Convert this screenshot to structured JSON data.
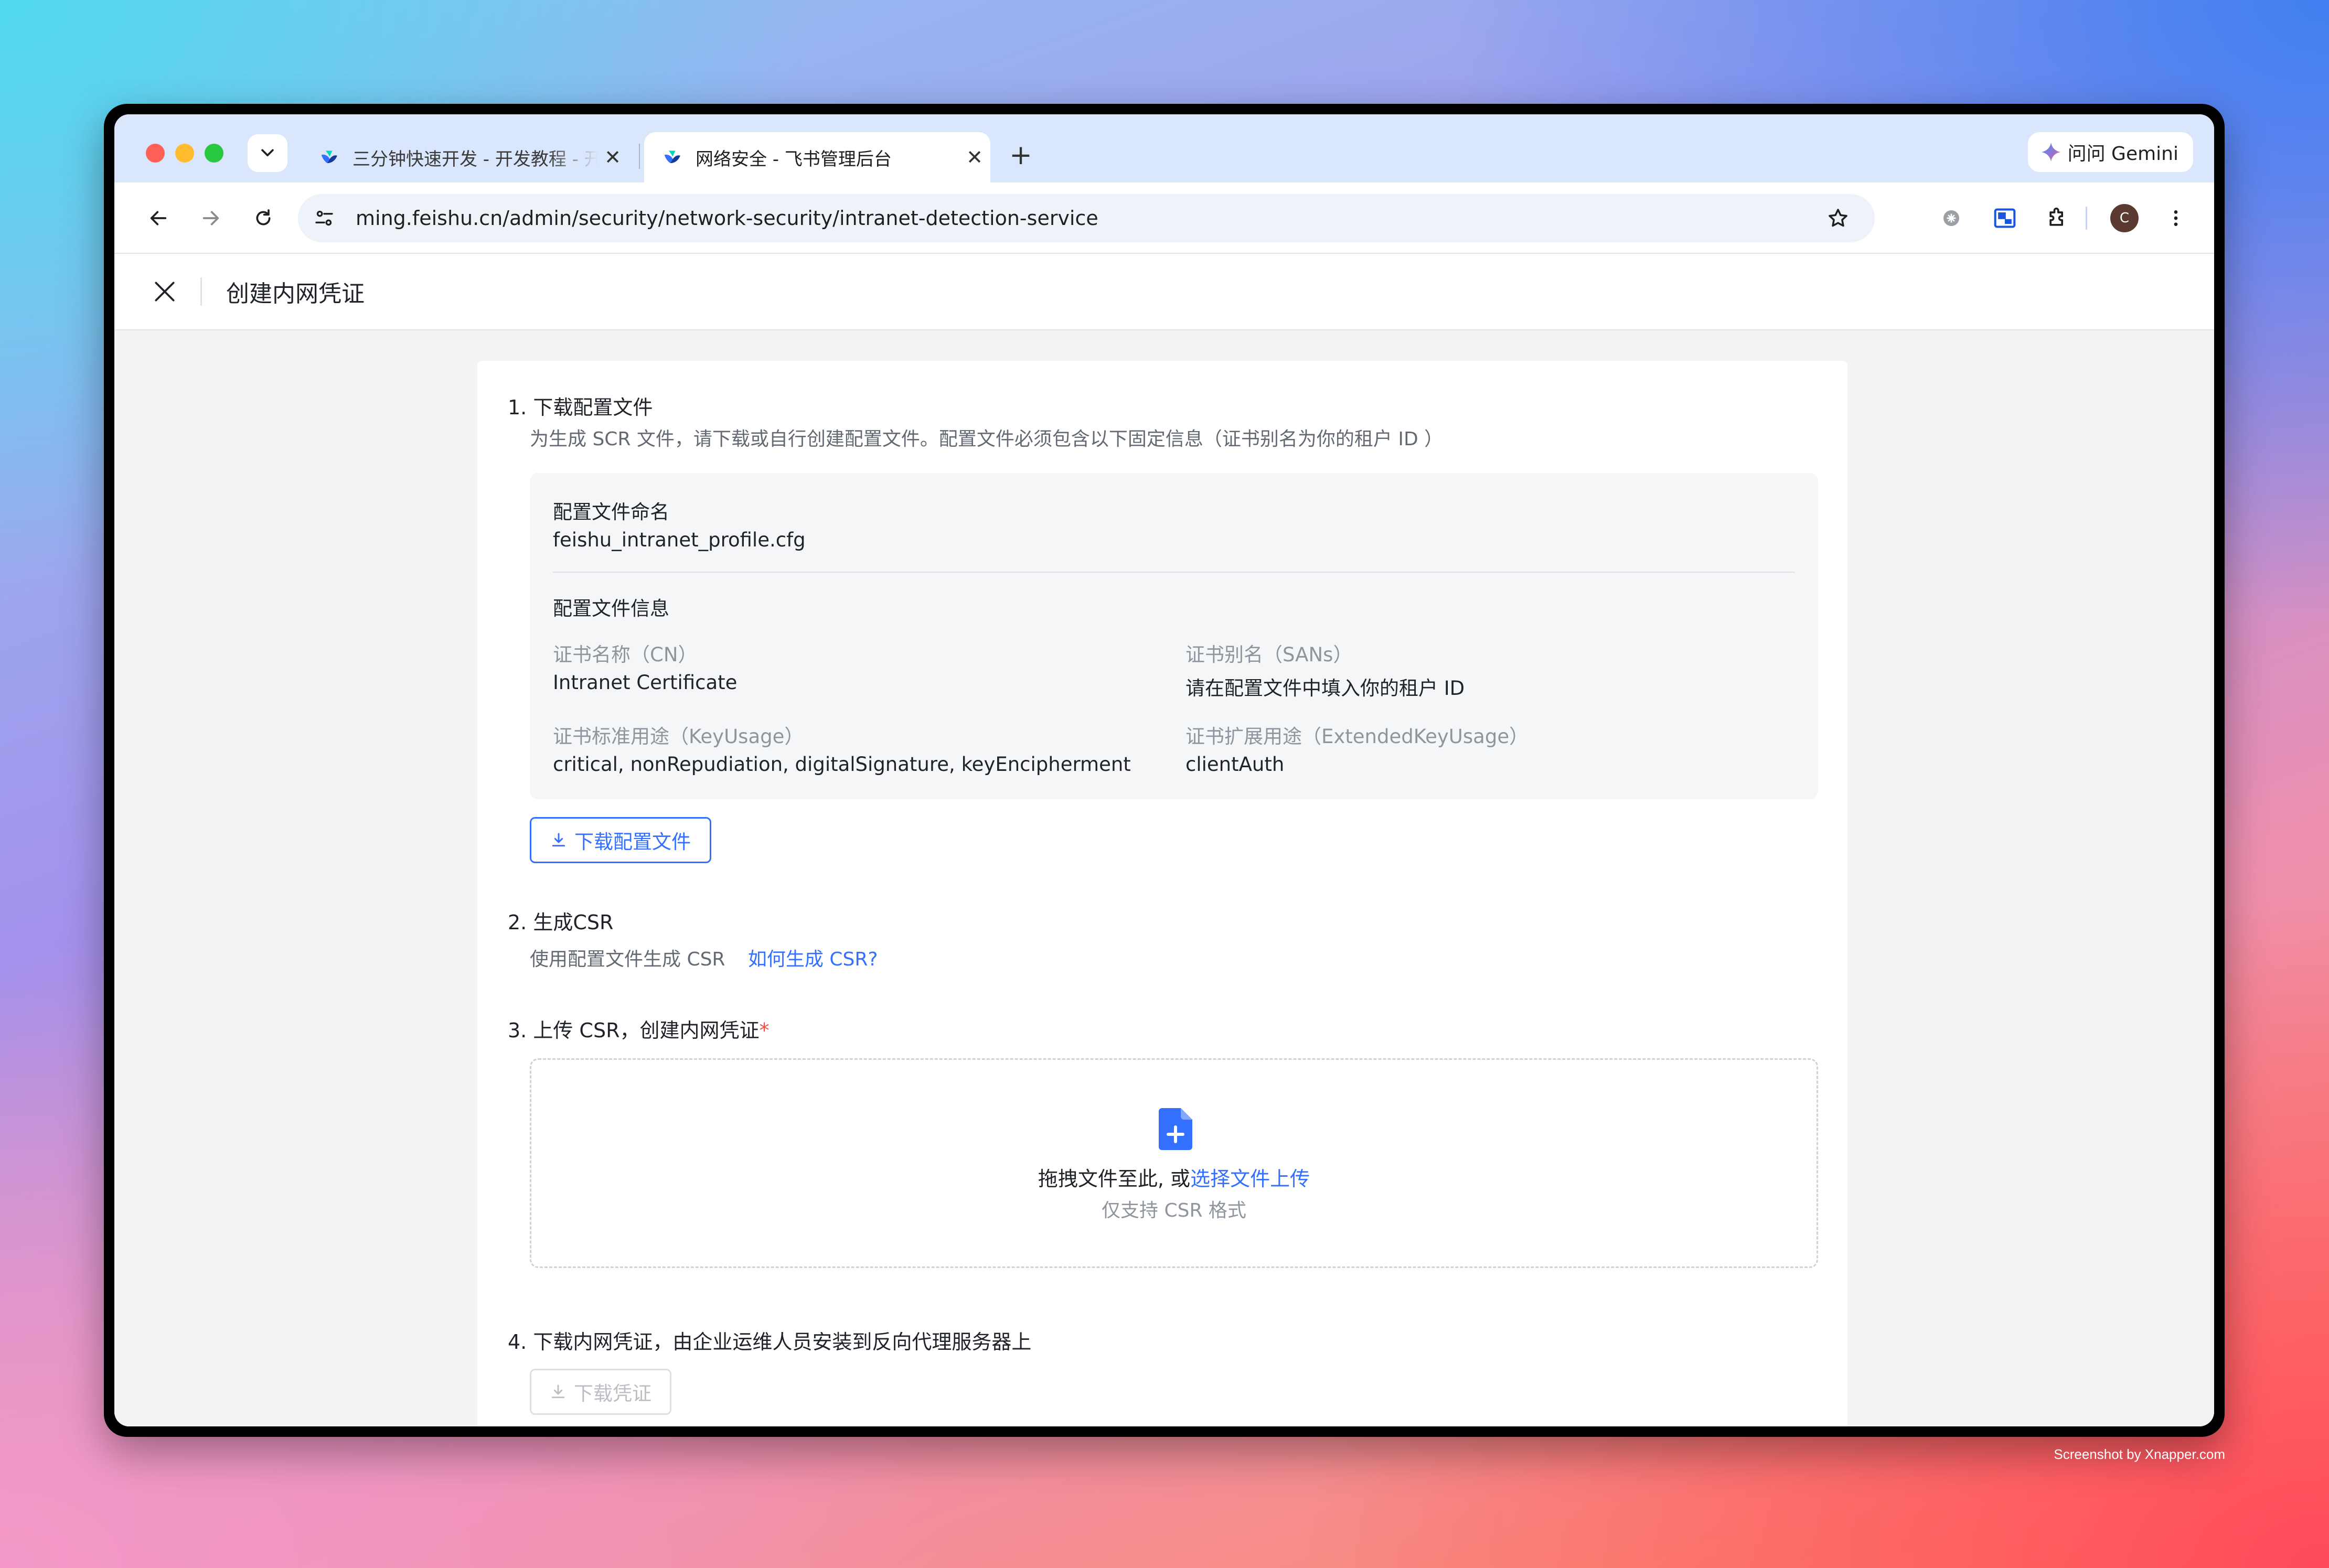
{
  "browser": {
    "tabs": [
      {
        "title": "三分钟快速开发 - 开发教程 - 开",
        "active": false
      },
      {
        "title": "网络安全 - 飞书管理后台",
        "active": true
      }
    ],
    "gemini_label": "问问 Gemini",
    "url": "ming.feishu.cn/admin/security/network-security/intranet-detection-service",
    "avatar_initial": "C",
    "icons": [
      "chevron-down-icon",
      "close-icon",
      "plus-icon",
      "back-icon",
      "forward-icon",
      "reload-icon",
      "site-settings-icon",
      "star-icon",
      "extension-icon",
      "puzzle-icon",
      "more-icon"
    ]
  },
  "page": {
    "title": "创建内网凭证",
    "step1": {
      "title": "1. 下载配置文件",
      "desc": "为生成 SCR 文件，请下载或自行创建配置文件。配置文件必须包含以下固定信息（证书别名为你的租户 ID ）",
      "filename_label": "配置文件命名",
      "filename_value": "feishu_intranet_profile.cfg",
      "info_label": "配置文件信息",
      "cn_label": "证书名称（CN）",
      "cn_value": "Intranet Certificate",
      "sans_label": "证书别名（SANs）",
      "sans_value": "请在配置文件中填入你的租户 ID",
      "keyusage_label": "证书标准用途（KeyUsage）",
      "keyusage_value": "critical, nonRepudiation, digitalSignature, keyEncipherment",
      "extkeyusage_label": "证书扩展用途（ExtendedKeyUsage）",
      "extkeyusage_value": "clientAuth",
      "download_button": "下载配置文件"
    },
    "step2": {
      "title": "2. 生成CSR",
      "desc": "使用配置文件生成 CSR",
      "help_link": "如何生成 CSR?"
    },
    "step3": {
      "title": "3. 上传 CSR，创建内网凭证",
      "required_mark": "*",
      "drop_text": "拖拽文件至此, 或",
      "select_link": "选择文件上传",
      "hint": "仅支持 CSR 格式"
    },
    "step4": {
      "title": "4. 下载内网凭证，由企业运维人员安装到反向代理服务器上",
      "download_button": "下载凭证"
    }
  },
  "watermark": "Screenshot by Xnapper.com",
  "colors": {
    "accent": "#3370ff",
    "required": "#f54a45",
    "page_bg": "#f2f3f5",
    "tabstrip_bg": "#dae6fb"
  }
}
